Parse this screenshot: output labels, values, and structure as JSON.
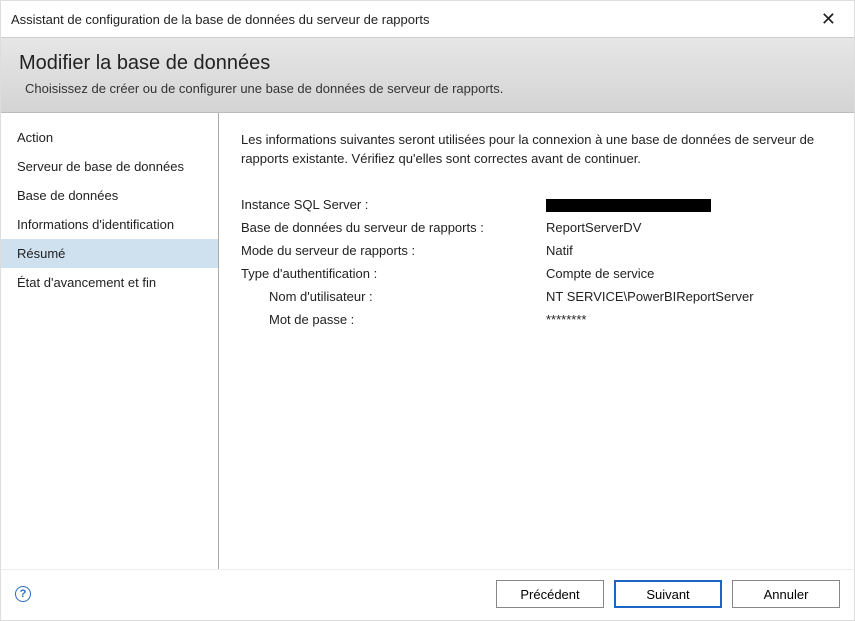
{
  "window": {
    "title": "Assistant de configuration de la base de données du serveur de rapports"
  },
  "header": {
    "title": "Modifier la base de données",
    "subtitle": "Choisissez de créer ou de configurer une base de données de serveur de rapports."
  },
  "sidebar": {
    "items": [
      {
        "label": "Action"
      },
      {
        "label": "Serveur de base de données"
      },
      {
        "label": "Base de données"
      },
      {
        "label": "Informations d'identification"
      },
      {
        "label": "Résumé",
        "selected": true
      },
      {
        "label": "État d'avancement et fin"
      }
    ]
  },
  "main": {
    "intro": "Les informations suivantes seront utilisées pour la connexion à une base de données de serveur de rapports existante.  Vérifiez qu'elles sont correctes avant de continuer.",
    "summary": {
      "sql_instance_label": "Instance SQL Server :",
      "sql_instance_value": "",
      "sql_instance_redacted": true,
      "db_label": "Base de données du serveur de rapports :",
      "db_value": "ReportServerDV",
      "mode_label": "Mode du serveur de rapports :",
      "mode_value": "Natif",
      "auth_label": "Type d'authentification :",
      "auth_value": "Compte de service",
      "user_label": "Nom d'utilisateur :",
      "user_value": "NT SERVICE\\PowerBIReportServer",
      "pass_label": "Mot de passe :",
      "pass_value": "********"
    }
  },
  "footer": {
    "previous": "Précédent",
    "next": "Suivant",
    "cancel": "Annuler"
  },
  "icons": {
    "help_glyph": "?"
  }
}
